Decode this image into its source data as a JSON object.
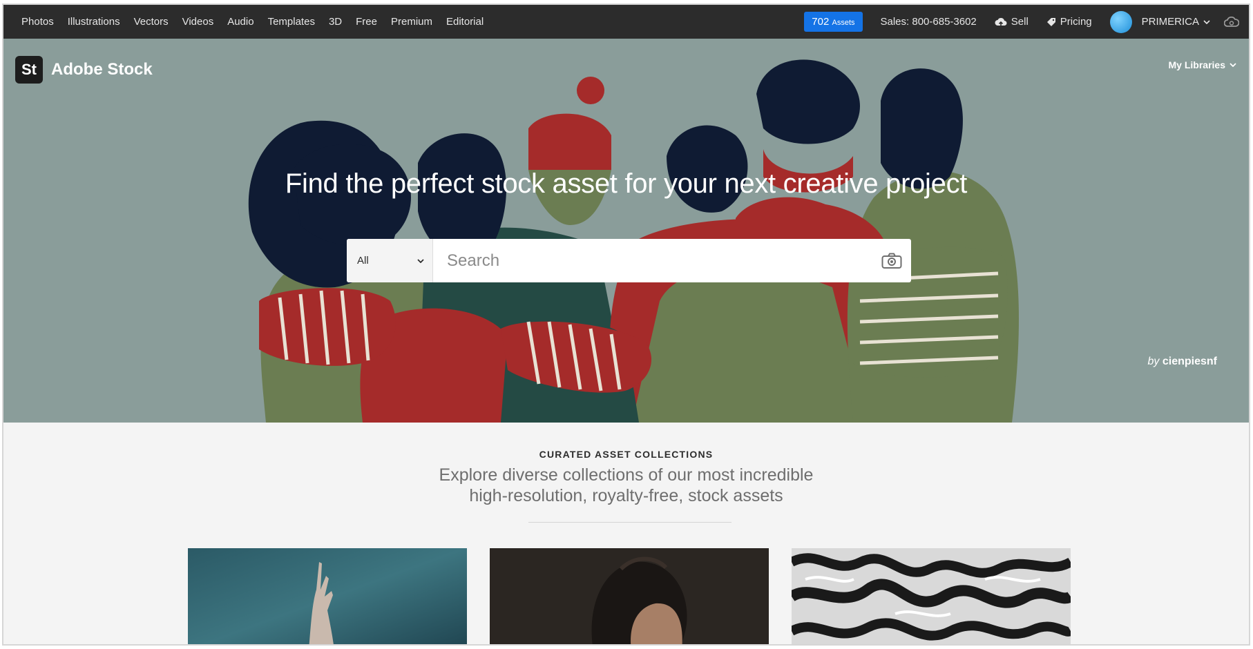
{
  "topnav": {
    "links": [
      "Photos",
      "Illustrations",
      "Vectors",
      "Videos",
      "Audio",
      "Templates",
      "3D",
      "Free",
      "Premium",
      "Editorial"
    ],
    "assets_count": "702",
    "assets_label": "Assets",
    "sales": "Sales: 800-685-3602",
    "sell": "Sell",
    "pricing": "Pricing",
    "account": "PRIMERICA"
  },
  "hero": {
    "logo_mark": "St",
    "logo_name": "Adobe Stock",
    "my_libraries": "My Libraries",
    "headline": "Find the perfect stock asset for your next creative project",
    "search": {
      "filter_value": "All",
      "placeholder": "Search"
    },
    "credit_by": "by",
    "credit_author": "cienpiesnf"
  },
  "curated": {
    "eyebrow": "CURATED ASSET COLLECTIONS",
    "subtitle": "Explore diverse collections of our most incredible high-resolution, royalty-free, stock assets"
  },
  "colors": {
    "accent": "#1473e6",
    "nav_bg": "#2c2c2c",
    "hero_bg": "#8a9d9a"
  }
}
